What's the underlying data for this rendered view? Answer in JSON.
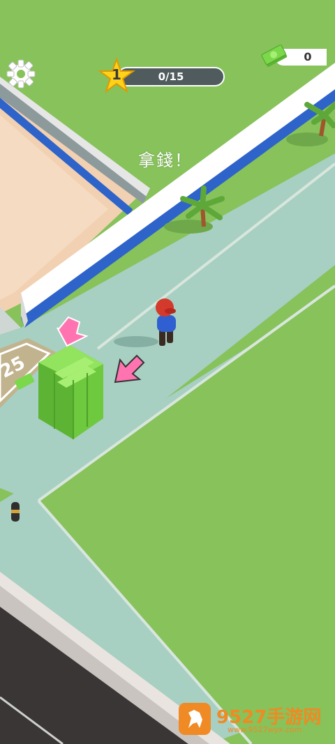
{
  "hud": {
    "settings_icon": "gear-icon",
    "level": "1",
    "progress_text": "0/15",
    "progress_fraction": 0,
    "money_icon": "cash-icon",
    "money": "0"
  },
  "scene": {
    "hint_text": "拿錢！",
    "zone_cost": "25",
    "colors": {
      "grass": "#87c25b",
      "sidewalk": "#a7cfc2",
      "floor": "#f2d1b2",
      "wall": "#ffffff",
      "wall_trim": "#2e63c9",
      "road": "#3a3636",
      "cash": "#7ad84a",
      "arrow": "#ff74b0"
    }
  },
  "watermark": {
    "title": "9527手游网",
    "url": "www.9527wyx.com"
  }
}
